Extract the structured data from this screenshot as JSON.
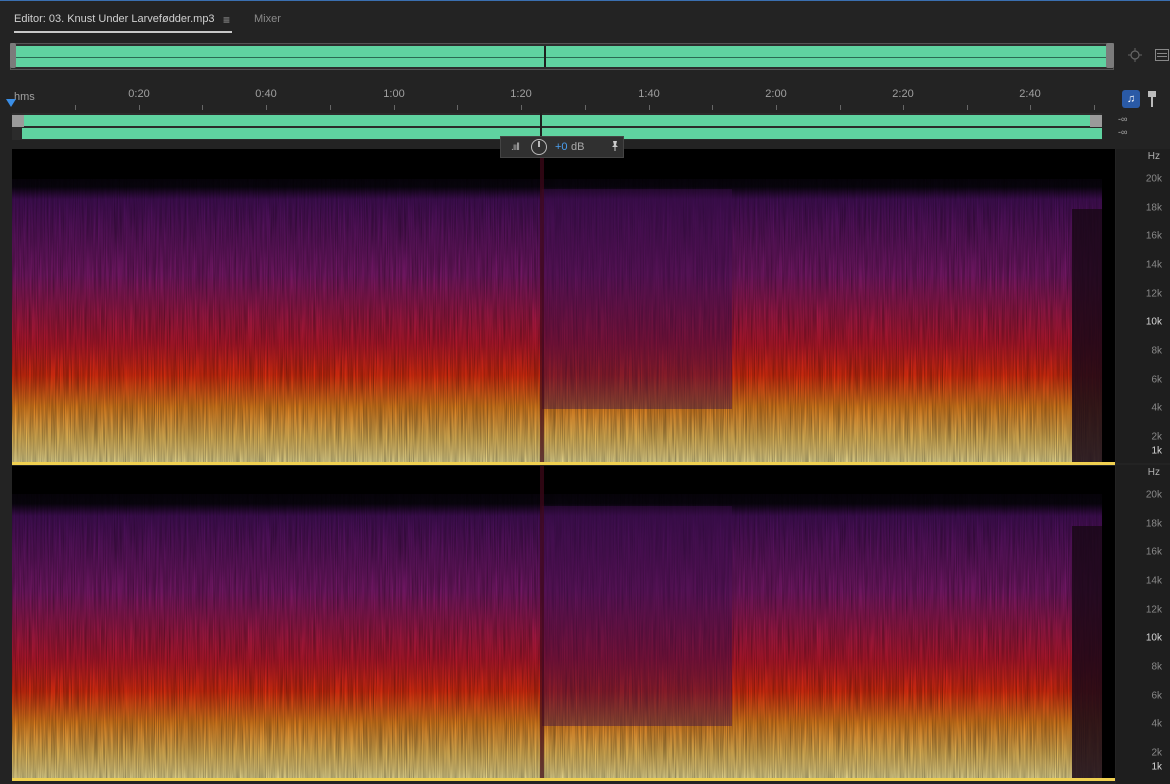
{
  "tabs": {
    "editor_label": "Editor: 03. Knust Under Larvefødder.mp3",
    "menu_glyph": "≡",
    "mixer_label": "Mixer"
  },
  "ruler": {
    "unit": "hms",
    "ticks": [
      "0:20",
      "0:40",
      "1:00",
      "1:20",
      "1:40",
      "2:00",
      "2:20",
      "2:40"
    ]
  },
  "levels": {
    "top": "-∞",
    "bottom": "-∞"
  },
  "gain": {
    "value": "+0",
    "unit": "dB",
    "meter_glyph": ".ııll",
    "pin_glyph": "📌"
  },
  "frequency_axis": {
    "unit": "Hz",
    "labels": [
      "20k",
      "18k",
      "16k",
      "14k",
      "12k",
      "10k",
      "8k",
      "6k",
      "4k",
      "2k",
      "1k"
    ]
  },
  "colors": {
    "waveform": "#5fd3a0",
    "accent": "#3a8ee6",
    "spectrogram_low": "#fff0a0",
    "spectrogram_mid": "#e8201a",
    "spectrogram_high": "#6a1a7a"
  }
}
